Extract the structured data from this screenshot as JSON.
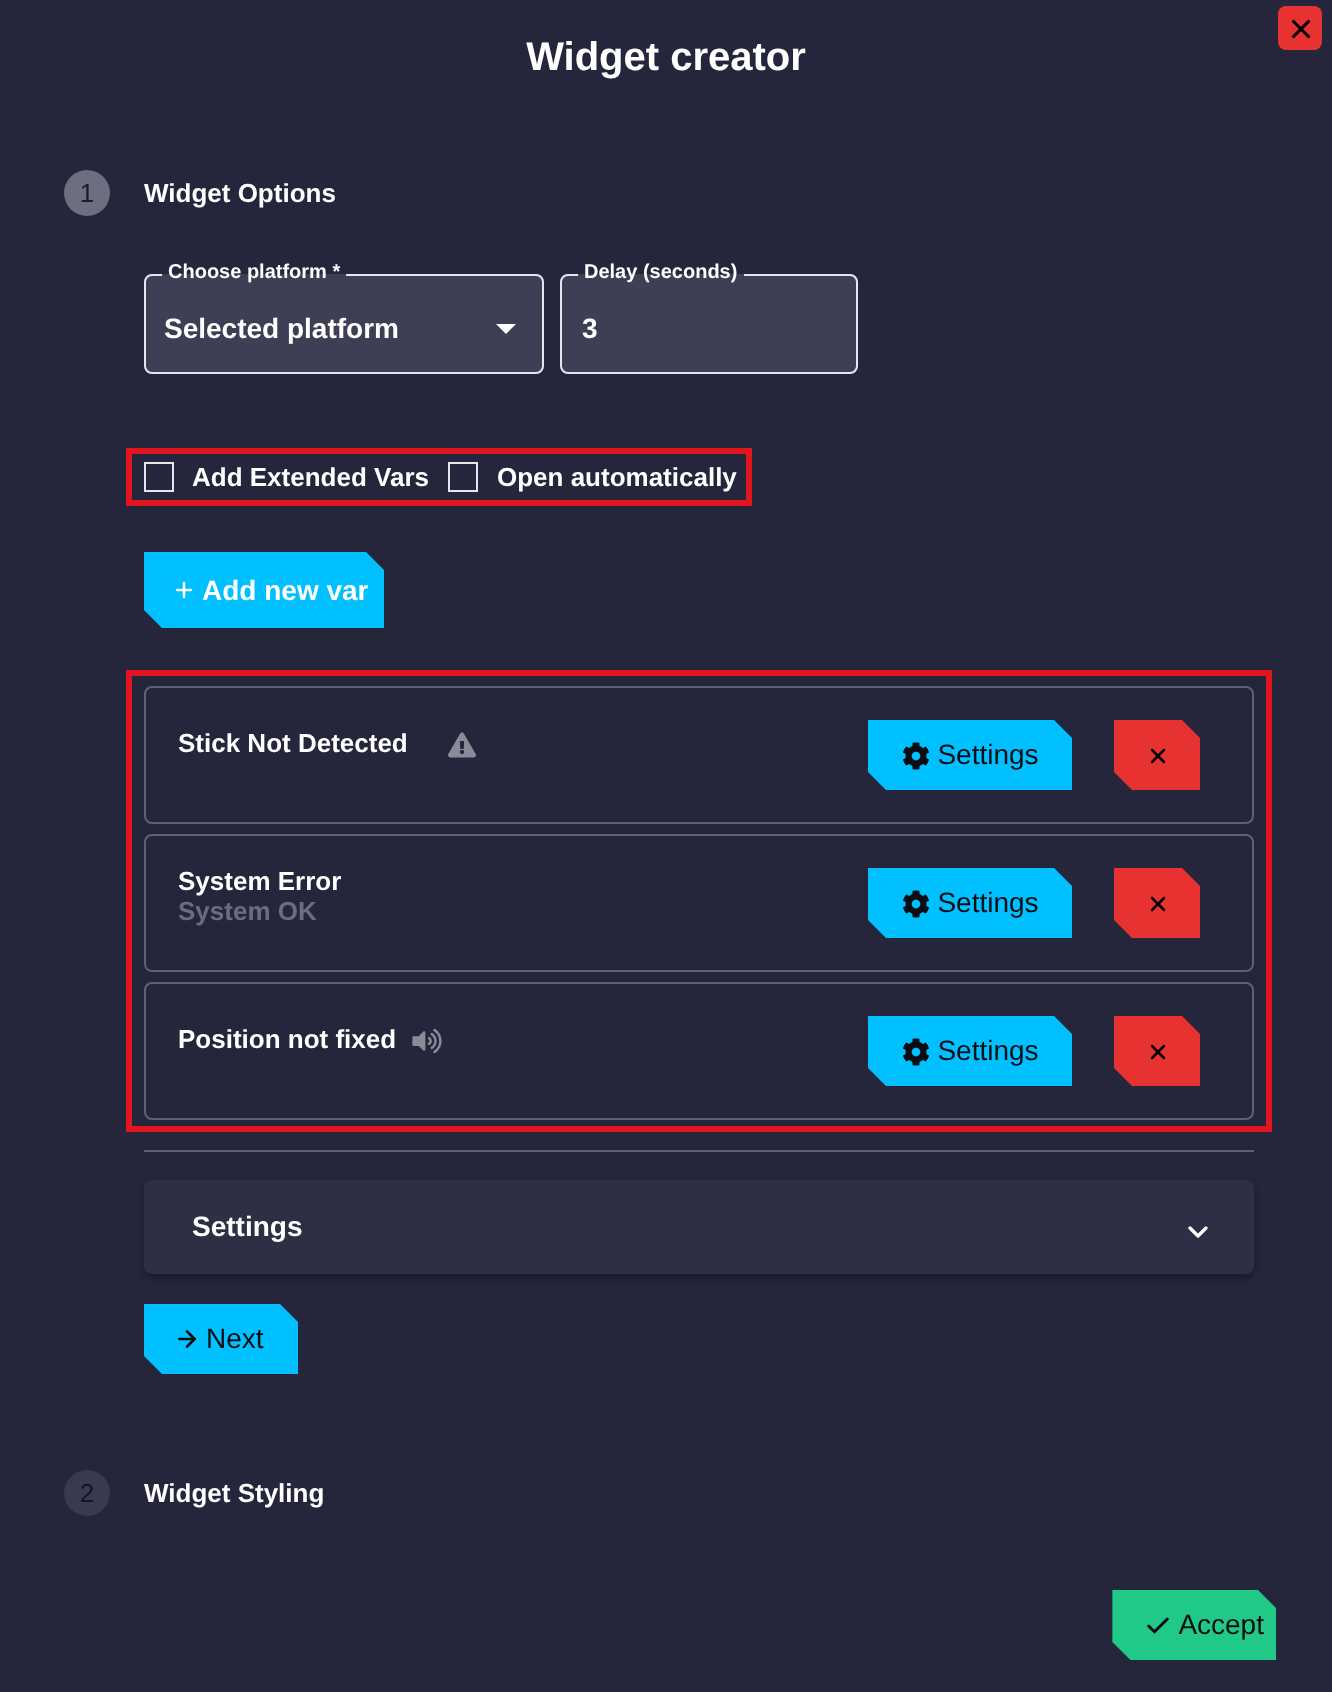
{
  "window": {
    "title": "Widget creator"
  },
  "steps": [
    {
      "number": "1",
      "title": "Widget Options",
      "active": true
    },
    {
      "number": "2",
      "title": "Widget Styling",
      "active": false
    }
  ],
  "options": {
    "platform": {
      "label": "Choose platform *",
      "value": "Selected platform"
    },
    "delay": {
      "label": "Delay (seconds)",
      "value": "3"
    },
    "highlighted": true,
    "checkboxes": [
      {
        "label": "Add Extended Vars",
        "checked": false
      },
      {
        "label": "Open automatically",
        "checked": false
      }
    ]
  },
  "add_button": "Add new var",
  "vars": {
    "highlighted": true,
    "items": [
      {
        "kind": "alert",
        "title": "Stick Not Detected",
        "button": "Settings"
      },
      {
        "kind": "status",
        "title": "System Error",
        "subtitle": "System OK",
        "button": "Settings"
      },
      {
        "kind": "audio",
        "title": "Position not fixed",
        "button": "Settings"
      }
    ]
  },
  "accordion": {
    "title": "Settings",
    "expanded": false
  },
  "next_button": "Next",
  "accept_button": "Accept"
}
